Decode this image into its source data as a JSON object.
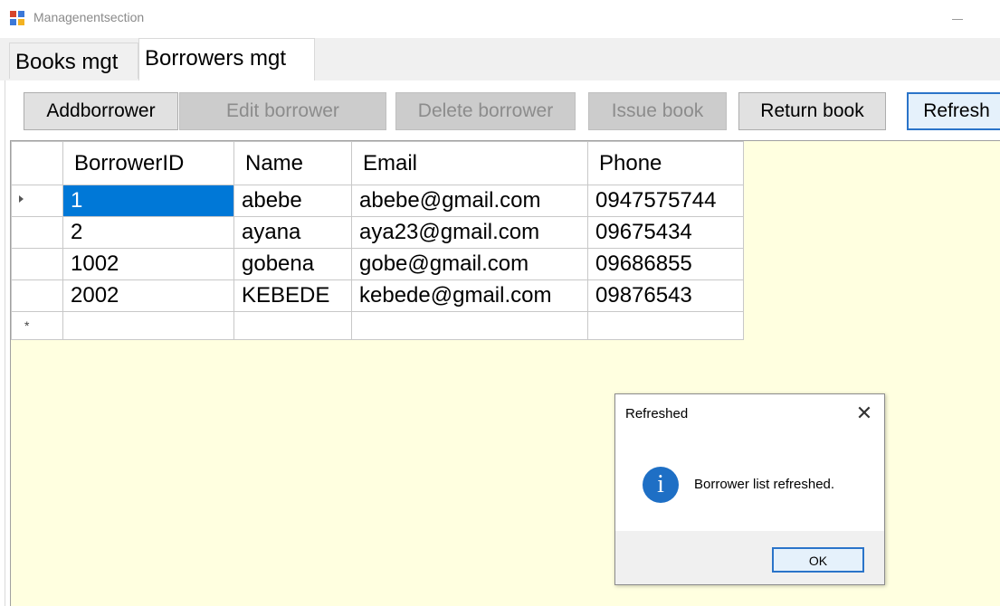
{
  "window": {
    "title": "Managenentsection",
    "minimize_label": "—"
  },
  "tabs": [
    {
      "label": "Books mgt"
    },
    {
      "label": "Borrowers mgt"
    }
  ],
  "toolbar": {
    "add_label": "Addborrower",
    "edit_label": "Edit borrower",
    "delete_label": "Delete borrower",
    "issue_label": "Issue book",
    "return_label": "Return book",
    "refresh_label": "Refresh"
  },
  "grid": {
    "columns": [
      "BorrowerID",
      "Name",
      "Email",
      "Phone"
    ],
    "rows": [
      [
        "1",
        "abebe",
        "abebe@gmail.com",
        "0947575744"
      ],
      [
        "2",
        "ayana",
        "aya23@gmail.com",
        "09675434"
      ],
      [
        "1002",
        "gobena",
        "gobe@gmail.com",
        "09686855"
      ],
      [
        "2002",
        "KEBEDE",
        "kebede@gmail.com",
        "09876543"
      ]
    ],
    "new_row_marker": "*",
    "grid_background": "#ffffe0",
    "selected_color": "#0078d7"
  },
  "dialog": {
    "title": "Refreshed",
    "message": "Borrower list refreshed.",
    "ok_label": "OK",
    "close_icon": "close-icon",
    "info_icon": "info-icon",
    "info_glyph": "i"
  }
}
